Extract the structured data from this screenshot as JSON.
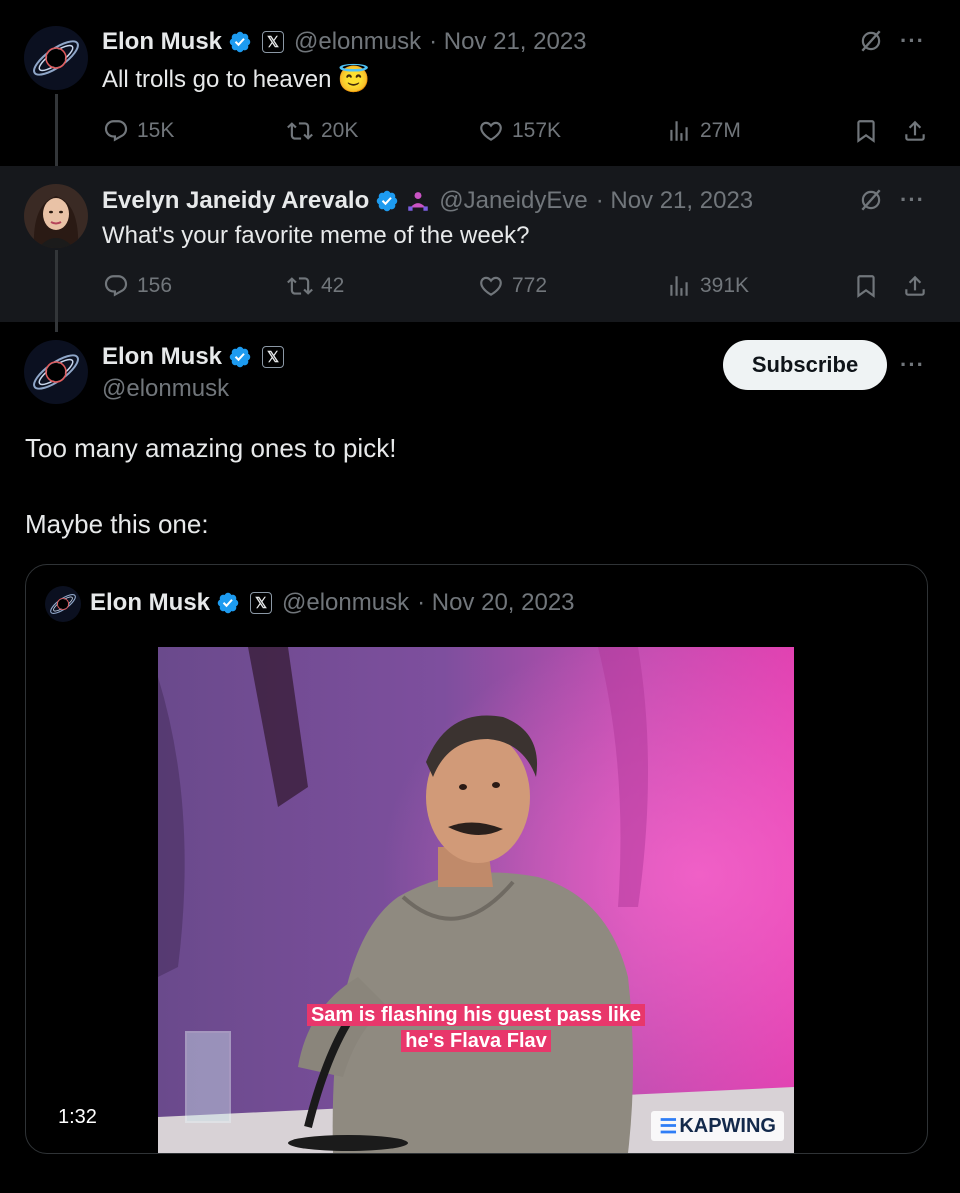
{
  "tweets": [
    {
      "name": "Elon Musk",
      "handle": "@elonmusk",
      "date": "· Nov 21, 2023",
      "text": "All trolls go to heaven",
      "emoji": "😇",
      "stats": {
        "replies": "15K",
        "reposts": "20K",
        "likes": "157K",
        "views": "27M"
      }
    },
    {
      "name": "Evelyn Janeidy Arevalo",
      "handle": "@JaneidyEve",
      "date": "· Nov 21, 2023",
      "text": "What's your favorite meme of the week?",
      "stats": {
        "replies": "156",
        "reposts": "42",
        "likes": "772",
        "views": "391K"
      }
    }
  ],
  "main_tweet": {
    "name": "Elon Musk",
    "handle": "@elonmusk",
    "subscribe_label": "Subscribe",
    "line1": "Too many amazing ones to pick!",
    "line2": "Maybe this one:"
  },
  "quoted": {
    "name": "Elon Musk",
    "handle": "@elonmusk",
    "date": "· Nov 20, 2023",
    "caption_line1": "Sam is flashing his guest pass like",
    "caption_line2": "he's Flava Flav",
    "duration": "1:32",
    "watermark": "KAPWING"
  },
  "icons": [
    "reply-icon",
    "repost-icon",
    "like-icon",
    "views-icon",
    "bookmark-icon",
    "share-icon",
    "grok-icon",
    "more-icon",
    "verified-icon",
    "x-affiliate-icon"
  ],
  "colors": {
    "background": "#000000",
    "thread_bg": "#16181c",
    "muted": "#71767b",
    "verified": "#1d9bf0",
    "subscribe_bg": "#eff3f4",
    "caption_bg": "#e8376b"
  }
}
